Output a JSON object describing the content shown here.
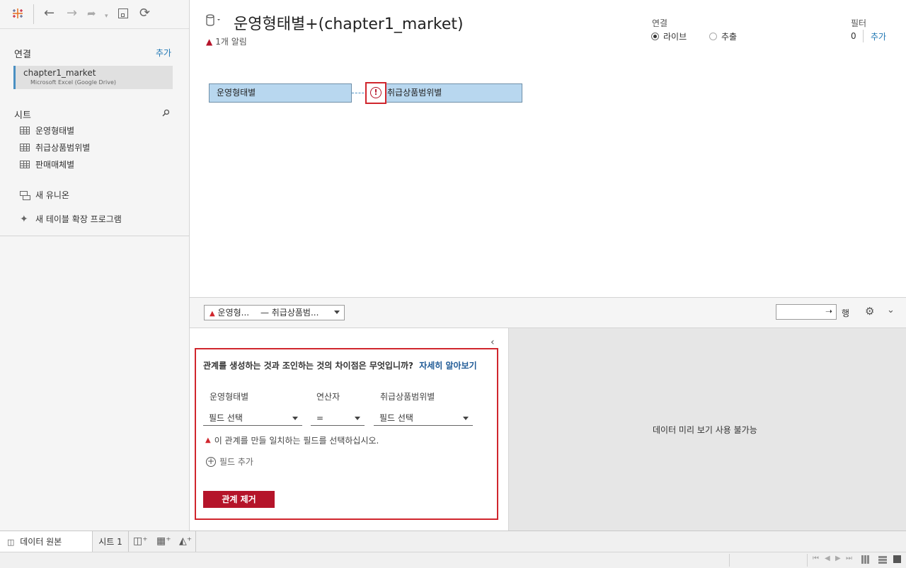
{
  "sidebar": {
    "connections_label": "연결",
    "add_label": "추가",
    "connection": {
      "name": "chapter1_market",
      "source": "Microsoft Excel (Google Drive)"
    },
    "sheets_label": "시트",
    "sheets": [
      "운영형태별",
      "취급상품범위별",
      "판매매체별"
    ],
    "new_union": "새 유니온",
    "new_extension": "새 테이블 확장 프로그램"
  },
  "header": {
    "title": "운영형태별+(chapter1_market)",
    "alert": "1개 알림",
    "connection_label": "연결",
    "live": "라이브",
    "extract": "추출",
    "filter_label": "필터",
    "filter_count": "0",
    "filter_add": "추가"
  },
  "canvas": {
    "table_left": "운영형태별",
    "table_right": "취급상품범위별"
  },
  "relation_bar": {
    "left": "운영형...",
    "separator": "—",
    "right": "취급상품범...",
    "rows_label": "행"
  },
  "editor": {
    "question": "관계를 생성하는 것과 조인하는 것의 차이점은 무엇입니까?",
    "learn_more": "자세히 알아보기",
    "col_left": "운영형태별",
    "col_op": "연산자",
    "col_right": "취급상품범위별",
    "select_left": "필드 선택",
    "operator": "=",
    "select_right": "필드 선택",
    "warning": "이 관계를 만들 일치하는 필드를 선택하십시오.",
    "add_field": "필드 추가",
    "remove": "관계 제거"
  },
  "preview": {
    "unavailable": "데이터 미리 보기 사용 불가능"
  },
  "tabs": {
    "data_source": "데이터 원본",
    "sheet1": "시트 1"
  },
  "colors": {
    "accent": "#1f77b4",
    "error": "#d0262d",
    "table_fill": "#b8d7ef"
  }
}
